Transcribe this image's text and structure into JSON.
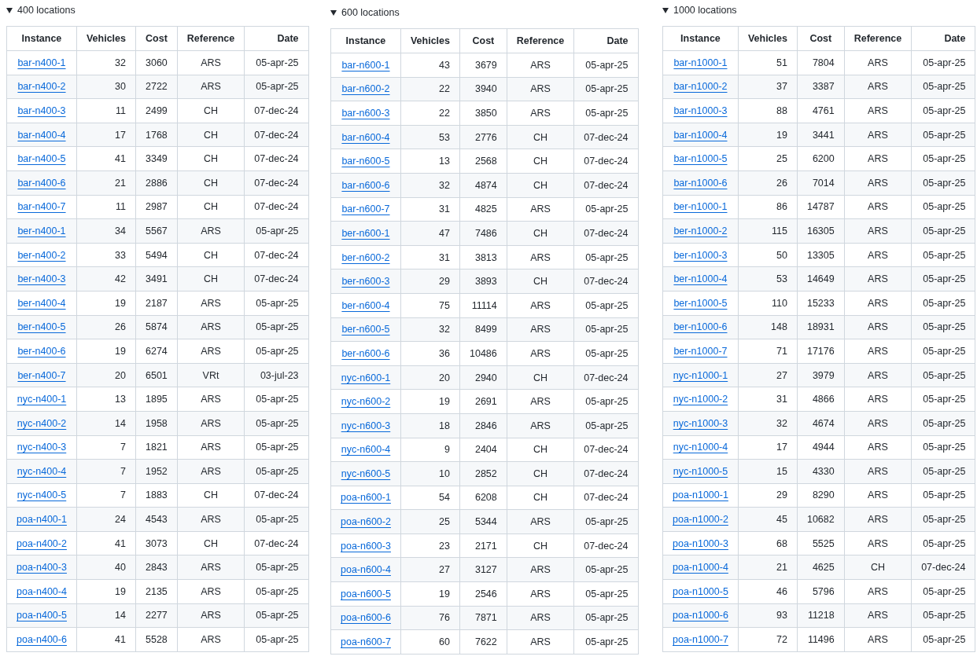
{
  "sections": [
    {
      "title": "400 locations",
      "expanded": true,
      "columns": [
        "Instance",
        "Vehicles",
        "Cost",
        "Reference",
        "Date"
      ],
      "rows": [
        [
          "bar-n400-1",
          "32",
          "3060",
          "ARS",
          "05-apr-25"
        ],
        [
          "bar-n400-2",
          "30",
          "2722",
          "ARS",
          "05-apr-25"
        ],
        [
          "bar-n400-3",
          "11",
          "2499",
          "CH",
          "07-dec-24"
        ],
        [
          "bar-n400-4",
          "17",
          "1768",
          "CH",
          "07-dec-24"
        ],
        [
          "bar-n400-5",
          "41",
          "3349",
          "CH",
          "07-dec-24"
        ],
        [
          "bar-n400-6",
          "21",
          "2886",
          "CH",
          "07-dec-24"
        ],
        [
          "bar-n400-7",
          "11",
          "2987",
          "CH",
          "07-dec-24"
        ],
        [
          "ber-n400-1",
          "34",
          "5567",
          "ARS",
          "05-apr-25"
        ],
        [
          "ber-n400-2",
          "33",
          "5494",
          "CH",
          "07-dec-24"
        ],
        [
          "ber-n400-3",
          "42",
          "3491",
          "CH",
          "07-dec-24"
        ],
        [
          "ber-n400-4",
          "19",
          "2187",
          "ARS",
          "05-apr-25"
        ],
        [
          "ber-n400-5",
          "26",
          "5874",
          "ARS",
          "05-apr-25"
        ],
        [
          "ber-n400-6",
          "19",
          "6274",
          "ARS",
          "05-apr-25"
        ],
        [
          "ber-n400-7",
          "20",
          "6501",
          "VRt",
          "03-jul-23"
        ],
        [
          "nyc-n400-1",
          "13",
          "1895",
          "ARS",
          "05-apr-25"
        ],
        [
          "nyc-n400-2",
          "14",
          "1958",
          "ARS",
          "05-apr-25"
        ],
        [
          "nyc-n400-3",
          "7",
          "1821",
          "ARS",
          "05-apr-25"
        ],
        [
          "nyc-n400-4",
          "7",
          "1952",
          "ARS",
          "05-apr-25"
        ],
        [
          "nyc-n400-5",
          "7",
          "1883",
          "CH",
          "07-dec-24"
        ],
        [
          "poa-n400-1",
          "24",
          "4543",
          "ARS",
          "05-apr-25"
        ],
        [
          "poa-n400-2",
          "41",
          "3073",
          "CH",
          "07-dec-24"
        ],
        [
          "poa-n400-3",
          "40",
          "2843",
          "ARS",
          "05-apr-25"
        ],
        [
          "poa-n400-4",
          "19",
          "2135",
          "ARS",
          "05-apr-25"
        ],
        [
          "poa-n400-5",
          "14",
          "2277",
          "ARS",
          "05-apr-25"
        ],
        [
          "poa-n400-6",
          "41",
          "5528",
          "ARS",
          "05-apr-25"
        ]
      ]
    },
    {
      "title": "600 locations",
      "expanded": true,
      "columns": [
        "Instance",
        "Vehicles",
        "Cost",
        "Reference",
        "Date"
      ],
      "rows": [
        [
          "bar-n600-1",
          "43",
          "3679",
          "ARS",
          "05-apr-25"
        ],
        [
          "bar-n600-2",
          "22",
          "3940",
          "ARS",
          "05-apr-25"
        ],
        [
          "bar-n600-3",
          "22",
          "3850",
          "ARS",
          "05-apr-25"
        ],
        [
          "bar-n600-4",
          "53",
          "2776",
          "CH",
          "07-dec-24"
        ],
        [
          "bar-n600-5",
          "13",
          "2568",
          "CH",
          "07-dec-24"
        ],
        [
          "bar-n600-6",
          "32",
          "4874",
          "CH",
          "07-dec-24"
        ],
        [
          "bar-n600-7",
          "31",
          "4825",
          "ARS",
          "05-apr-25"
        ],
        [
          "ber-n600-1",
          "47",
          "7486",
          "CH",
          "07-dec-24"
        ],
        [
          "ber-n600-2",
          "31",
          "3813",
          "ARS",
          "05-apr-25"
        ],
        [
          "ber-n600-3",
          "29",
          "3893",
          "CH",
          "07-dec-24"
        ],
        [
          "ber-n600-4",
          "75",
          "11114",
          "ARS",
          "05-apr-25"
        ],
        [
          "ber-n600-5",
          "32",
          "8499",
          "ARS",
          "05-apr-25"
        ],
        [
          "ber-n600-6",
          "36",
          "10486",
          "ARS",
          "05-apr-25"
        ],
        [
          "nyc-n600-1",
          "20",
          "2940",
          "CH",
          "07-dec-24"
        ],
        [
          "nyc-n600-2",
          "19",
          "2691",
          "ARS",
          "05-apr-25"
        ],
        [
          "nyc-n600-3",
          "18",
          "2846",
          "ARS",
          "05-apr-25"
        ],
        [
          "nyc-n600-4",
          "9",
          "2404",
          "CH",
          "07-dec-24"
        ],
        [
          "nyc-n600-5",
          "10",
          "2852",
          "CH",
          "07-dec-24"
        ],
        [
          "poa-n600-1",
          "54",
          "6208",
          "CH",
          "07-dec-24"
        ],
        [
          "poa-n600-2",
          "25",
          "5344",
          "ARS",
          "05-apr-25"
        ],
        [
          "poa-n600-3",
          "23",
          "2171",
          "CH",
          "07-dec-24"
        ],
        [
          "poa-n600-4",
          "27",
          "3127",
          "ARS",
          "05-apr-25"
        ],
        [
          "poa-n600-5",
          "19",
          "2546",
          "ARS",
          "05-apr-25"
        ],
        [
          "poa-n600-6",
          "76",
          "7871",
          "ARS",
          "05-apr-25"
        ],
        [
          "poa-n600-7",
          "60",
          "7622",
          "ARS",
          "05-apr-25"
        ]
      ]
    },
    {
      "title": "1000 locations",
      "expanded": true,
      "columns": [
        "Instance",
        "Vehicles",
        "Cost",
        "Reference",
        "Date"
      ],
      "rows": [
        [
          "bar-n1000-1",
          "51",
          "7804",
          "ARS",
          "05-apr-25"
        ],
        [
          "bar-n1000-2",
          "37",
          "3387",
          "ARS",
          "05-apr-25"
        ],
        [
          "bar-n1000-3",
          "88",
          "4761",
          "ARS",
          "05-apr-25"
        ],
        [
          "bar-n1000-4",
          "19",
          "3441",
          "ARS",
          "05-apr-25"
        ],
        [
          "bar-n1000-5",
          "25",
          "6200",
          "ARS",
          "05-apr-25"
        ],
        [
          "bar-n1000-6",
          "26",
          "7014",
          "ARS",
          "05-apr-25"
        ],
        [
          "ber-n1000-1",
          "86",
          "14787",
          "ARS",
          "05-apr-25"
        ],
        [
          "ber-n1000-2",
          "115",
          "16305",
          "ARS",
          "05-apr-25"
        ],
        [
          "ber-n1000-3",
          "50",
          "13305",
          "ARS",
          "05-apr-25"
        ],
        [
          "ber-n1000-4",
          "53",
          "14649",
          "ARS",
          "05-apr-25"
        ],
        [
          "ber-n1000-5",
          "110",
          "15233",
          "ARS",
          "05-apr-25"
        ],
        [
          "ber-n1000-6",
          "148",
          "18931",
          "ARS",
          "05-apr-25"
        ],
        [
          "ber-n1000-7",
          "71",
          "17176",
          "ARS",
          "05-apr-25"
        ],
        [
          "nyc-n1000-1",
          "27",
          "3979",
          "ARS",
          "05-apr-25"
        ],
        [
          "nyc-n1000-2",
          "31",
          "4866",
          "ARS",
          "05-apr-25"
        ],
        [
          "nyc-n1000-3",
          "32",
          "4674",
          "ARS",
          "05-apr-25"
        ],
        [
          "nyc-n1000-4",
          "17",
          "4944",
          "ARS",
          "05-apr-25"
        ],
        [
          "nyc-n1000-5",
          "15",
          "4330",
          "ARS",
          "05-apr-25"
        ],
        [
          "poa-n1000-1",
          "29",
          "8290",
          "ARS",
          "05-apr-25"
        ],
        [
          "poa-n1000-2",
          "45",
          "10682",
          "ARS",
          "05-apr-25"
        ],
        [
          "poa-n1000-3",
          "68",
          "5525",
          "ARS",
          "05-apr-25"
        ],
        [
          "poa-n1000-4",
          "21",
          "4625",
          "CH",
          "07-dec-24"
        ],
        [
          "poa-n1000-5",
          "46",
          "5796",
          "ARS",
          "05-apr-25"
        ],
        [
          "poa-n1000-6",
          "93",
          "11218",
          "ARS",
          "05-apr-25"
        ],
        [
          "poa-n1000-7",
          "72",
          "11496",
          "ARS",
          "05-apr-25"
        ]
      ]
    }
  ]
}
